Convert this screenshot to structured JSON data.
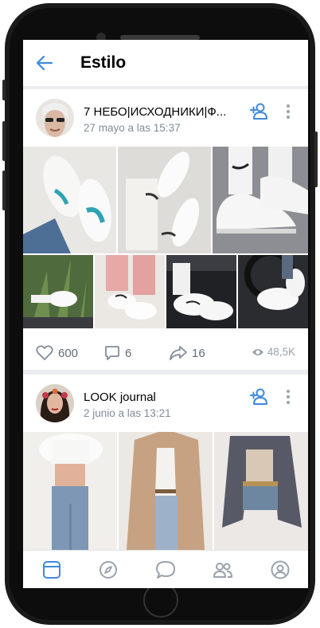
{
  "header": {
    "title": "Estilo"
  },
  "posts": [
    {
      "author": "7 НЕБО|ИСХОДНИКИ|Ф...",
      "date": "27 mayo a las 15:37",
      "likes": "600",
      "comments": "6",
      "shares": "16",
      "views": "48,5K"
    },
    {
      "author": "LOOK journal",
      "date": "2 junio a las 13:21"
    }
  ],
  "colors": {
    "accent": "#3f8ae0",
    "secondary": "#818c99",
    "background": "#ebedf0"
  },
  "icons": [
    "back-arrow-icon",
    "add-friend-icon",
    "more-icon",
    "heart-icon",
    "comment-icon",
    "share-icon",
    "eye-icon",
    "newsfeed-icon",
    "discover-icon",
    "messages-icon",
    "friends-icon",
    "profile-icon"
  ]
}
